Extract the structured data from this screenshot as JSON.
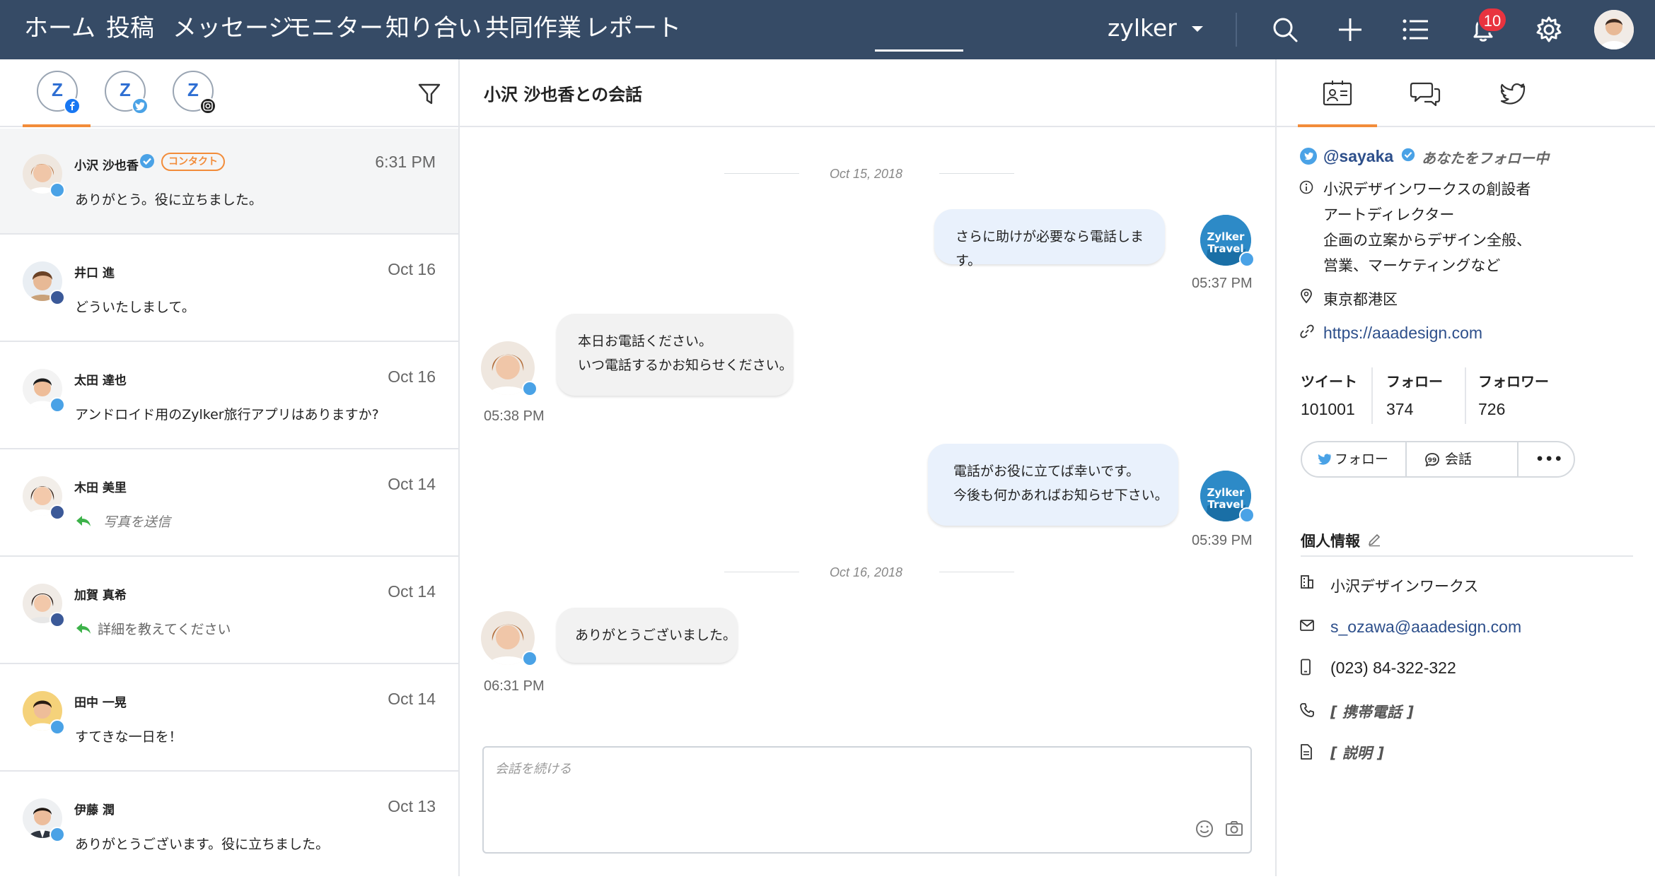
{
  "nav": {
    "items": [
      "ホーム",
      "投稿",
      "メッセージ",
      "モニター",
      "知り合い",
      "共同作業",
      "レポート"
    ],
    "active": "レポート",
    "brand": "zylker",
    "notification_count": "10"
  },
  "left": {
    "tabs": [
      "facebook",
      "twitter",
      "instagram"
    ],
    "conversations": [
      {
        "name": "小沢 沙也香",
        "time": "6:31 PM",
        "message": "ありがとう。役に立ちました。",
        "network": "twitter",
        "verified": true,
        "tag": "コンタクト"
      },
      {
        "name": "井口 進",
        "time": "Oct 16",
        "message": "どういたしまして。",
        "network": "facebook"
      },
      {
        "name": "太田 達也",
        "time": "Oct 16",
        "message": "アンドロイド用のZylker旅行アプリはありますか?",
        "network": "twitter"
      },
      {
        "name": "木田 美里",
        "time": "Oct 14",
        "message": "写真を送信",
        "network": "facebook",
        "reply": true
      },
      {
        "name": "加賀 真希",
        "time": "Oct 14",
        "message": "詳細を教えてください",
        "network": "facebook",
        "reply": true
      },
      {
        "name": "田中 一晃",
        "time": "Oct 14",
        "message": "すてきな一日を！",
        "network": "twitter"
      },
      {
        "name": "伊藤 潤",
        "time": "Oct 13",
        "message": "ありがとうございます。役に立ちました。",
        "network": "twitter"
      }
    ]
  },
  "chat": {
    "title": "小沢 沙也香との会話",
    "date1": "Oct 15, 2018",
    "date2": "Oct 16, 2018",
    "brand_avatar": [
      "Zylker",
      "Travel"
    ],
    "messages": [
      {
        "dir": "out",
        "lines": [
          "さらに助けが必要なら電話します。"
        ],
        "time": "05:37 PM"
      },
      {
        "dir": "in",
        "lines": [
          "本日お電話ください。",
          "いつ電話するかお知らせください。"
        ],
        "time": "05:38 PM"
      },
      {
        "dir": "out",
        "lines": [
          "電話がお役に立てば幸いです。",
          "今後も何かあればお知らせ下さい。"
        ],
        "time": "05:39 PM"
      },
      {
        "dir": "in",
        "lines": [
          "ありがとうございました。"
        ],
        "time": "06:31 PM"
      }
    ],
    "composer_placeholder": "会話を続ける"
  },
  "profile": {
    "handle": "@sayaka",
    "following": "あなたをフォロー中",
    "bio": [
      "小沢デザインワークスの創設者",
      "アートディレクター",
      "企画の立案からデザイン全般、",
      "営業、マーケティングなど"
    ],
    "location": "東京都港区",
    "website": "https://aaadesign.com",
    "stats": [
      {
        "label": "ツイート",
        "value": "101001"
      },
      {
        "label": "フォロー",
        "value": "374"
      },
      {
        "label": "フォロワー",
        "value": "726"
      }
    ],
    "actions": {
      "follow": "フォロー",
      "chat": "会話",
      "more": "•••"
    },
    "personal_title": "個人情報",
    "company": "小沢デザインワークス",
    "email": "s_ozawa@aaadesign.com",
    "phone": "(023) 84-322-322",
    "mobile": "[ 携帯電話 ]",
    "description": "[ 説明 ]"
  },
  "colors": {
    "header": "#364b66",
    "accent": "#f28c3a",
    "twitter": "#4aa2e6",
    "facebook": "#3b5998",
    "link": "#2d4f8b",
    "badge": "#e8333f"
  }
}
